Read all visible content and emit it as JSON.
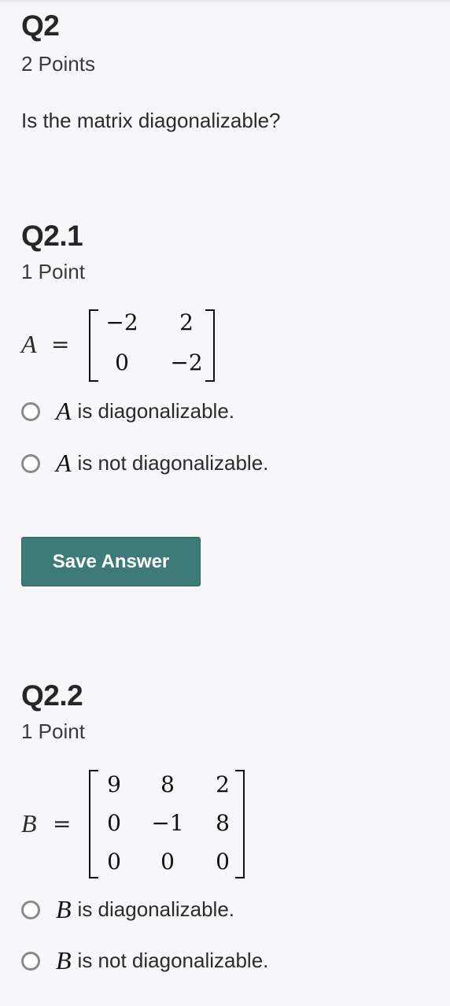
{
  "q2": {
    "title": "Q2",
    "points": "2 Points",
    "prompt": "Is the matrix diagonalizable?"
  },
  "q21": {
    "title": "Q2.1",
    "points": "1 Point",
    "matrix_name": "A",
    "equals": "=",
    "matrix": [
      [
        "−2",
        "2"
      ],
      [
        "0",
        "−2"
      ]
    ],
    "options": [
      {
        "var": "A",
        "text": "is diagonalizable."
      },
      {
        "var": "A",
        "text": "is not diagonalizable."
      }
    ],
    "save_label": "Save Answer"
  },
  "q22": {
    "title": "Q2.2",
    "points": "1 Point",
    "matrix_name": "B",
    "equals": "=",
    "matrix": [
      [
        "9",
        "8",
        "2"
      ],
      [
        "0",
        "−1",
        "8"
      ],
      [
        "0",
        "0",
        "0"
      ]
    ],
    "options": [
      {
        "var": "B",
        "text": "is diagonalizable."
      },
      {
        "var": "B",
        "text": "is not diagonalizable."
      }
    ]
  },
  "colors": {
    "accent_button": "#3c7b77",
    "background": "#f7f7f9",
    "radio_border": "#8a8a8a"
  }
}
